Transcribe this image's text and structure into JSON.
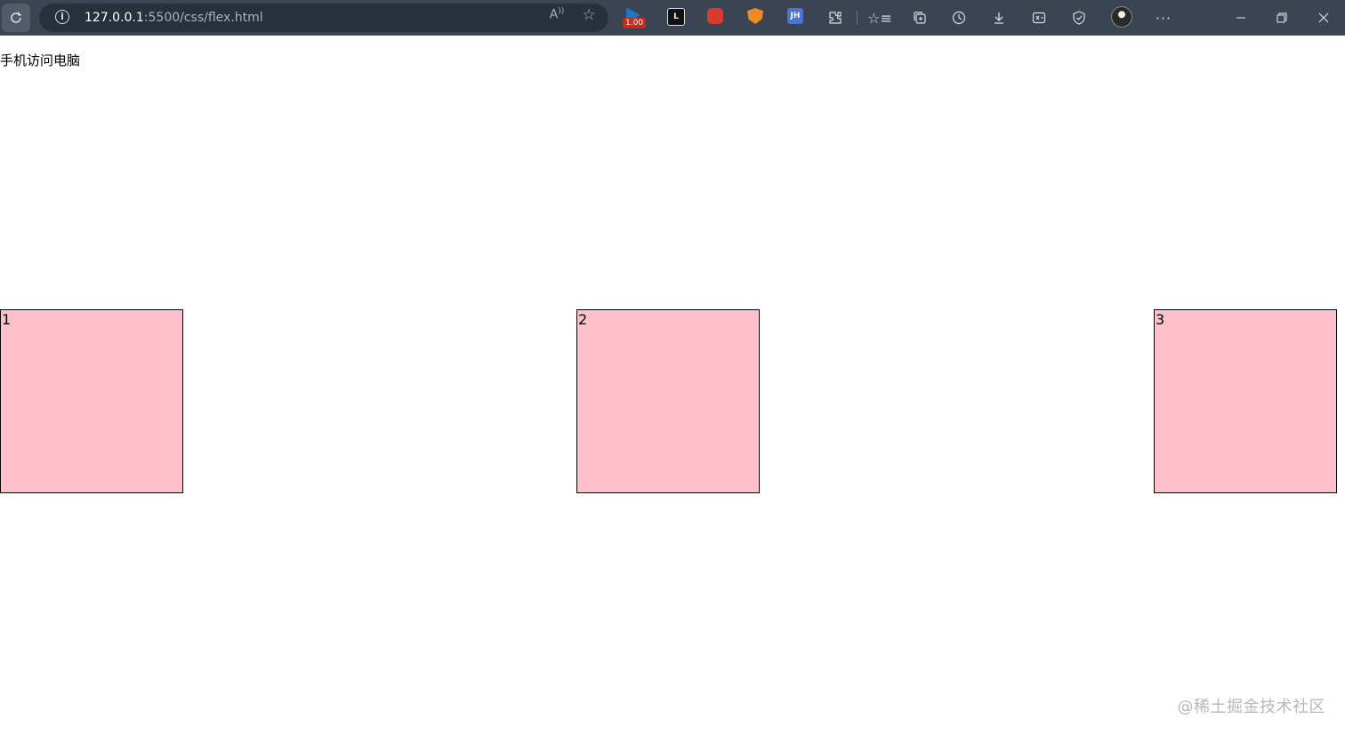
{
  "browser": {
    "url_host": "127.0.0.1",
    "url_path": ":5500/css/flex.html",
    "read_aloud_label": "Ȃ",
    "extension_badge": "1.00",
    "extension_l_label": "L",
    "extension_jh_label": "JH"
  },
  "page": {
    "heading": "手机访问电脑",
    "boxes": [
      "1",
      "2",
      "3"
    ],
    "box_color": "#ffc0cb"
  },
  "watermark": "@稀土掘金技术社区"
}
